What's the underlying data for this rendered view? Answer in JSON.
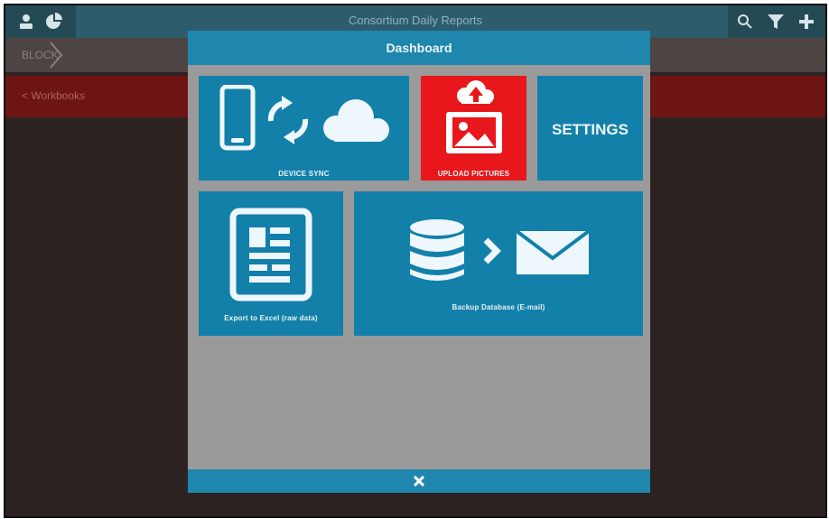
{
  "app": {
    "title": "Consortium Daily Reports",
    "breadcrumb": "BLOCK",
    "section_label": "< Workbooks"
  },
  "icons": {
    "topbar_left": [
      "user-icon",
      "pie-chart-icon"
    ],
    "topbar_right": [
      "search-icon",
      "filter-icon",
      "plus-icon"
    ]
  },
  "dashboard": {
    "title": "Dashboard",
    "close_icon": "close-icon",
    "tiles": [
      {
        "id": "device-sync",
        "label": "DEVICE SYNC",
        "color": "#1380aa"
      },
      {
        "id": "upload-pictures",
        "label": "UPLOAD PICTURES",
        "color": "#e8171b"
      },
      {
        "id": "settings",
        "label": "SETTINGS",
        "color": "#1380aa"
      },
      {
        "id": "export-excel",
        "label": "Export to Excel (raw data)",
        "color": "#1380aa"
      },
      {
        "id": "backup-database",
        "label": "Backup Database (E-mail)",
        "color": "#1380aa"
      }
    ]
  },
  "colors": {
    "accent": "#1f86ad",
    "tile": "#1380aa",
    "highlight": "#e8171b",
    "modal_bg": "#9a9a9a"
  }
}
